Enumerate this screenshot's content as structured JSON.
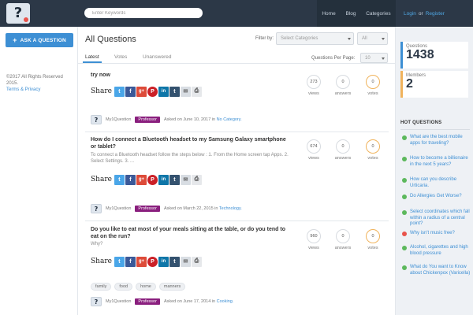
{
  "header": {
    "search_placeholder": "Enter Keywords",
    "nav": [
      "Home",
      "Blog",
      "Categories"
    ],
    "login": "Login",
    "or": "or",
    "register": "Register"
  },
  "left": {
    "ask_button": "ASK A QUESTION",
    "copyright": "©2017 All Rights Reserved 2015.",
    "terms": "Terms & Privacy"
  },
  "main": {
    "title": "All Questions",
    "filter_label": "Filter by:",
    "category_select": "Select Categories",
    "scope_select": "All",
    "tabs": [
      "Latest",
      "Votes",
      "Unanswered"
    ],
    "per_page_label": "Questions Per Page:",
    "per_page_value": "10",
    "share_word": "Share",
    "labels": {
      "views": "views",
      "answers": "answers",
      "votes": "votes",
      "asked_on": "Asked on"
    },
    "questions": [
      {
        "title": "try now",
        "excerpt": "",
        "views": "273",
        "answers": "0",
        "votes": "0",
        "user": "My1Question",
        "role": "Professor",
        "date": "June 10, 2017",
        "in": "in",
        "category": "No Category."
      },
      {
        "title": "How do I connect a Bluetooth headset to my Samsung Galaxy smartphone or tablet?",
        "excerpt": "To connect a Bluetooth headset follow the steps below :   1. From the Home screen tap Apps. 2. Select Settings. 3. ...",
        "views": "674",
        "answers": "0",
        "votes": "0",
        "user": "My1Question",
        "role": "Professor",
        "date": "March 22, 2015",
        "in": "in",
        "category": "Technology."
      },
      {
        "title": "Do you like to eat most of your meals sitting at the table, or do you tend to eat on the run?",
        "excerpt": "Why?",
        "views": "960",
        "answers": "0",
        "votes": "0",
        "tags": [
          "family",
          "food",
          "home",
          "manners"
        ],
        "user": "My1Question",
        "role": "Professor",
        "date": "June 17, 2014",
        "in": "in",
        "category": "Cooking."
      }
    ]
  },
  "right": {
    "questions_label": "Questions",
    "questions_count": "1438",
    "members_label": "Members",
    "members_count": "2",
    "hot_title": "HOT QUESTIONS",
    "hot": [
      {
        "text": "What are the best mobile apps for traveling?",
        "status": "green"
      },
      {
        "text": "How to become a billionaire in the next 5 years?",
        "status": "green"
      },
      {
        "text": "How can you describe Urticaria.",
        "status": "green"
      },
      {
        "text": "Do Allergies Get Worse?",
        "status": "green"
      },
      {
        "text": "Select coordinates which fall within a radius of a central point?",
        "status": "green"
      },
      {
        "text": "Why isn't music free?",
        "status": "red"
      },
      {
        "text": "Alcohol, cigarettes and high blood pressure",
        "status": "green"
      },
      {
        "text": "What do You want to Know about Chickenpox (Varicella)",
        "status": "green"
      }
    ]
  },
  "colors": {
    "header": "#2c3847",
    "accent": "#3d8fd4",
    "badge": "#8a1f7e",
    "answers_ring": "#f0b35c"
  }
}
